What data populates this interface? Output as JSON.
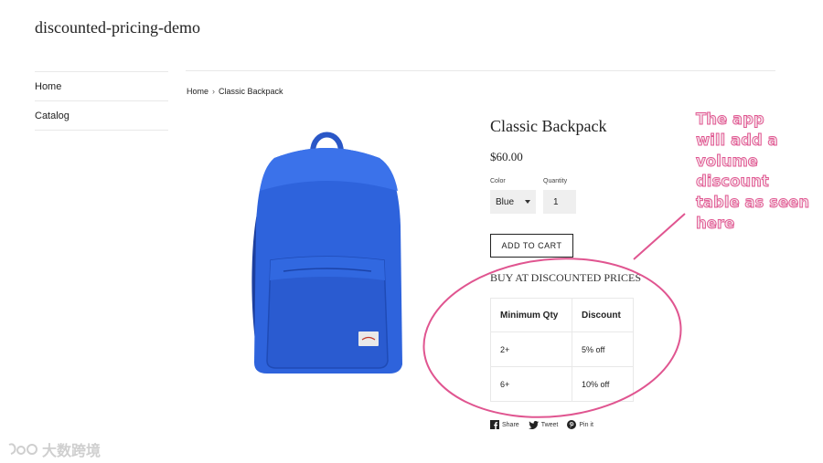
{
  "store": {
    "title": "discounted-pricing-demo"
  },
  "sidebar": {
    "items": [
      {
        "label": "Home"
      },
      {
        "label": "Catalog"
      }
    ]
  },
  "breadcrumb": {
    "home": "Home",
    "separator": "›",
    "current": "Classic Backpack"
  },
  "product": {
    "title": "Classic Backpack",
    "price": "$60.00",
    "color_label": "Color",
    "color_value": "Blue",
    "quantity_label": "Quantity",
    "quantity_value": "1",
    "add_to_cart_label": "ADD TO CART"
  },
  "discount": {
    "heading": "BUY AT DISCOUNTED PRICES",
    "columns": [
      "Minimum Qty",
      "Discount"
    ],
    "rows": [
      [
        "2+",
        "5% off"
      ],
      [
        "6+",
        "10% off"
      ]
    ]
  },
  "social": {
    "share": "Share",
    "tweet": "Tweet",
    "pin": "Pin it"
  },
  "annotation": {
    "lines": [
      "The app",
      "will add a",
      "volume",
      "discount",
      "table as seen",
      "here"
    ],
    "color": "#e05590"
  },
  "watermark": {
    "text": "大数跨境"
  },
  "colors": {
    "backpack": "#2d5fd6",
    "text": "#222222"
  }
}
